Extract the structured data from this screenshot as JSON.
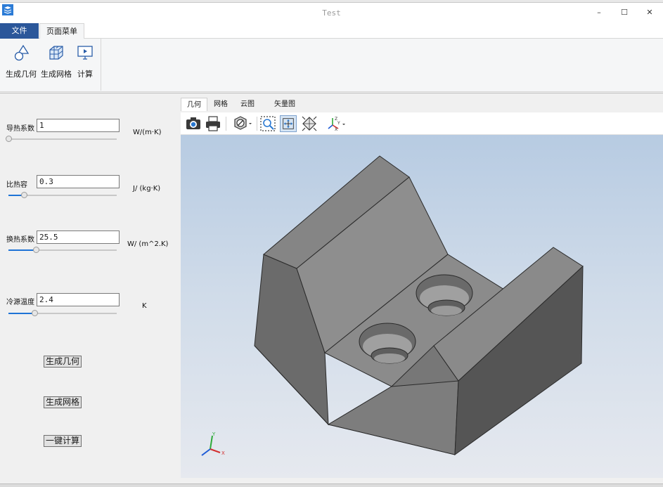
{
  "window": {
    "title": "Test",
    "min_glyph": "–",
    "max_glyph": "☐",
    "close_glyph": "✕"
  },
  "ribbon": {
    "tabs": [
      {
        "label": "文件"
      },
      {
        "label": "页面菜单"
      }
    ],
    "items": [
      {
        "label": "生成几何",
        "icon": "geometry-icon"
      },
      {
        "label": "生成网格",
        "icon": "mesh-icon"
      },
      {
        "label": "计算",
        "icon": "compute-icon"
      }
    ]
  },
  "params": [
    {
      "label": "导热系数",
      "value": "1",
      "unit": "W/(m·K)",
      "slider": 0.0
    },
    {
      "label": "比热容",
      "value": "0.3",
      "unit": "J/ (kg·K)",
      "slider": 0.14
    },
    {
      "label": "换热系数",
      "value": "25.5",
      "unit": "W/ (m^2.K)",
      "slider": 0.25
    },
    {
      "label": "冷源温度",
      "value": "2.4",
      "unit": "K",
      "slider": 0.24
    }
  ],
  "actions": {
    "geometry": "生成几何",
    "mesh": "生成网格",
    "compute": "一键计算"
  },
  "view_tabs": [
    {
      "label": "几何"
    },
    {
      "label": "网格"
    },
    {
      "label": "云图"
    },
    {
      "label": "矢量图"
    }
  ],
  "toolbar": {
    "icons": [
      "screenshot-icon",
      "print-icon",
      "display-mode-icon",
      "zoom-box-icon",
      "fit-all-icon",
      "view-iso-icon",
      "axes-orientation-icon"
    ]
  },
  "triad": {
    "x": "X",
    "y": "Y",
    "z": "Z"
  },
  "colors": {
    "accent": "#2b579a",
    "slider": "#1e73d6",
    "model_top": "#8c8c8c",
    "model_front": "#6e6e6e",
    "model_side": "#5a5a5a"
  }
}
